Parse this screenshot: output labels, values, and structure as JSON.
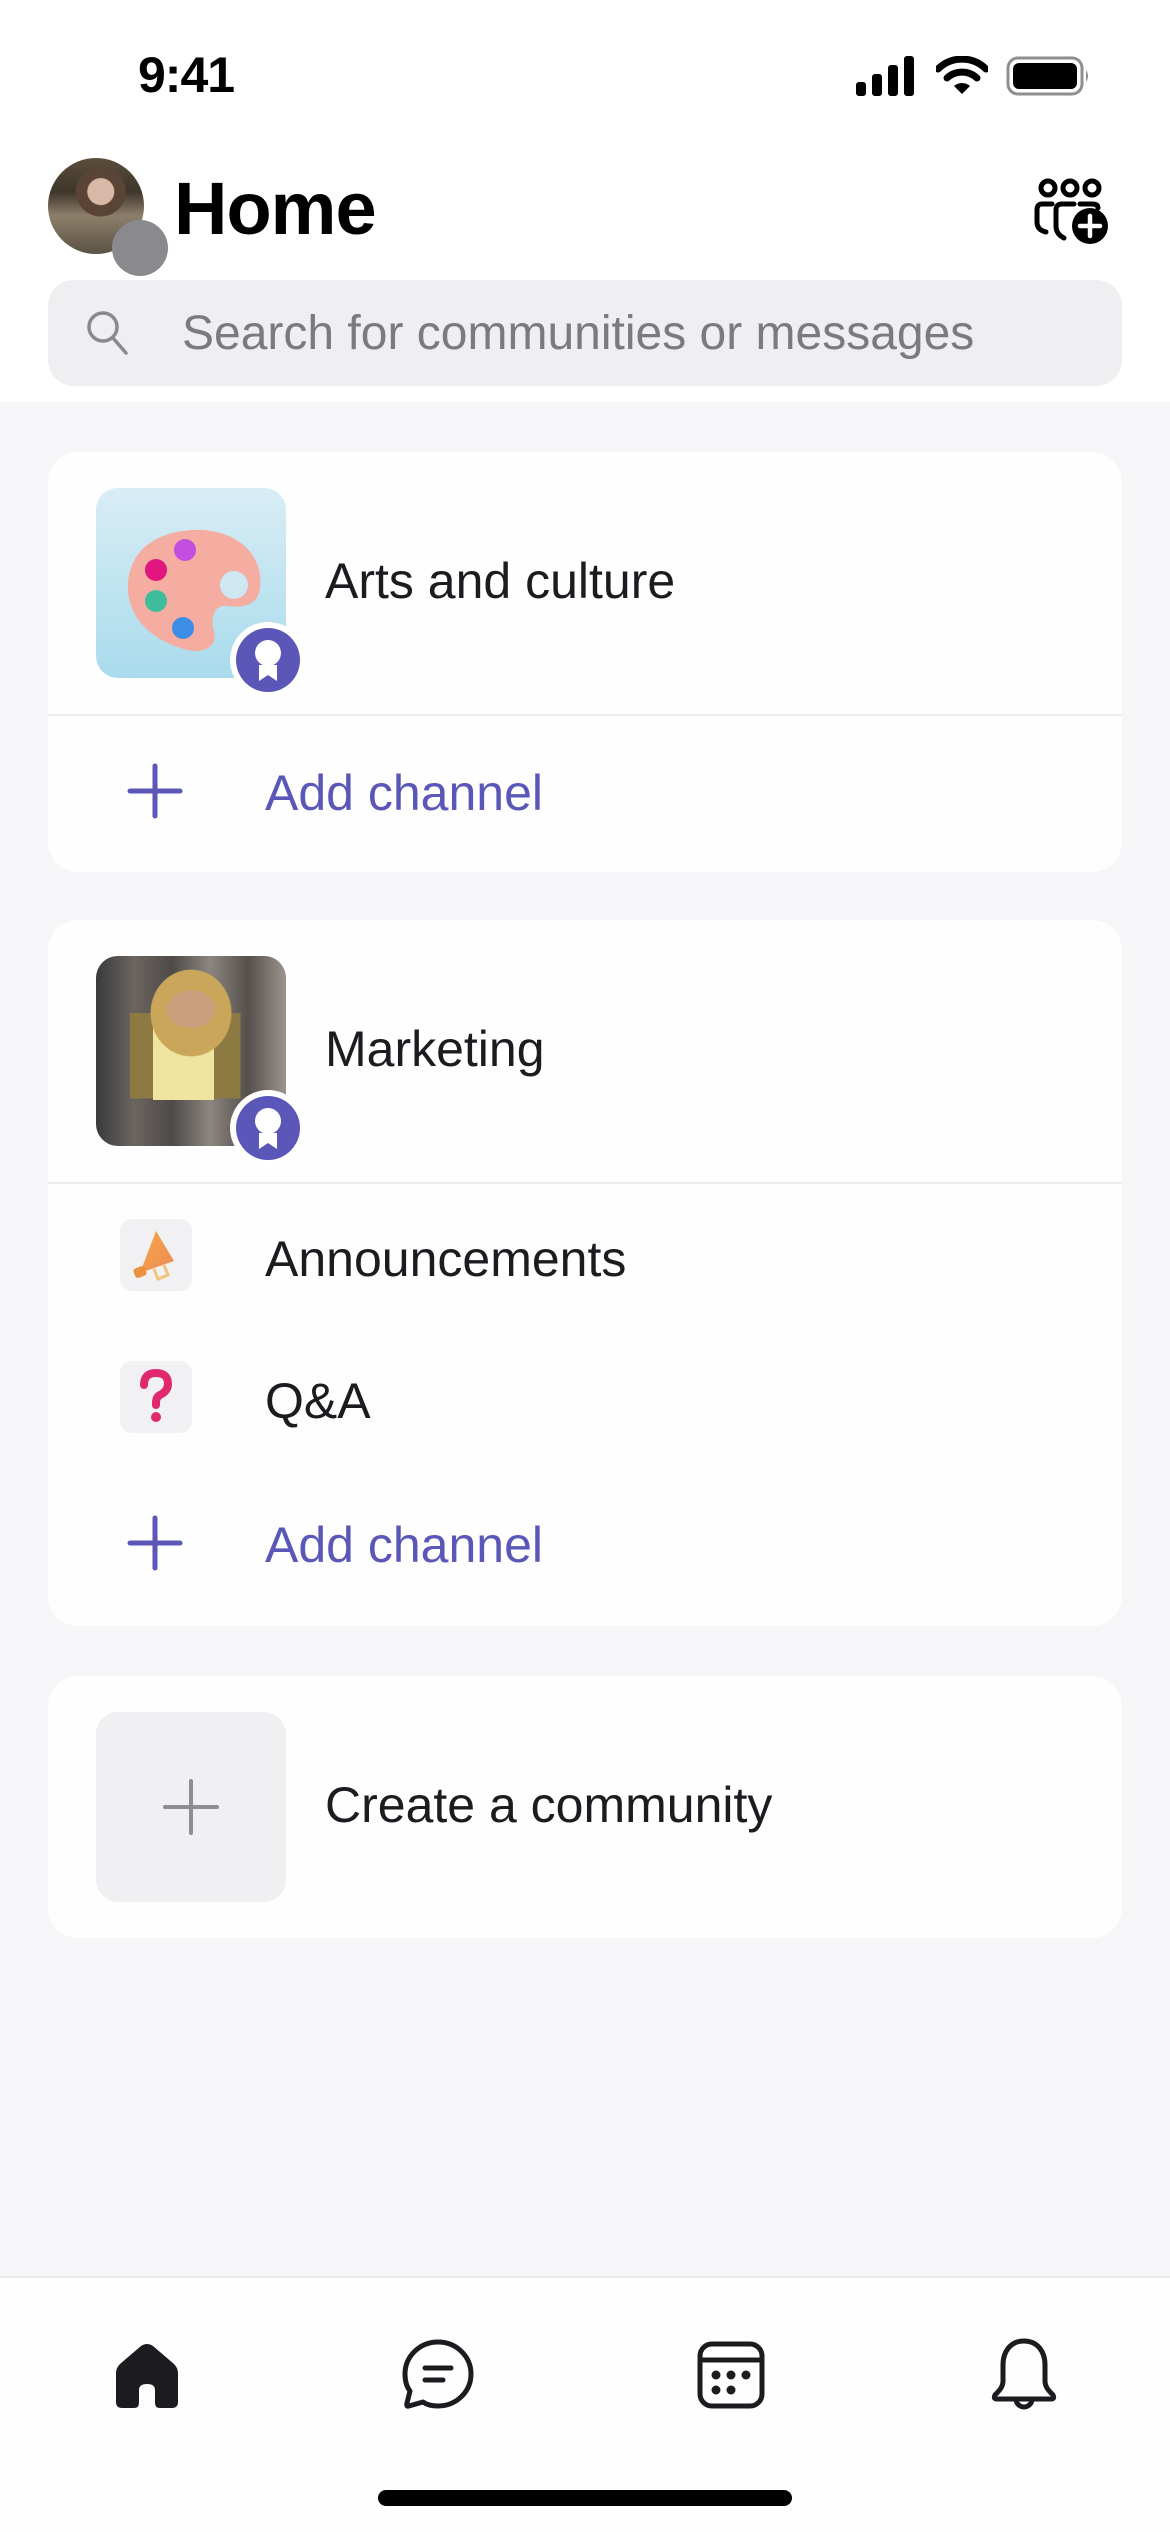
{
  "status_bar": {
    "time": "9:41",
    "icons": [
      "cellular-signal-icon",
      "wifi-icon",
      "battery-icon"
    ]
  },
  "header": {
    "title": "Home",
    "avatar_alt": "User avatar",
    "presence": "offline",
    "action_icon": "community-add-icon"
  },
  "search": {
    "placeholder": "Search for communities or messages",
    "value": "",
    "icon": "search-icon"
  },
  "communities": [
    {
      "name": "Arts and culture",
      "thumbnail": "palette-icon",
      "badge": "award-ribbon-icon",
      "channels": [],
      "add_channel_label": "Add channel"
    },
    {
      "name": "Marketing",
      "thumbnail": "photo-woman-plaid-blazer",
      "badge": "award-ribbon-icon",
      "channels": [
        {
          "label": "Announcements",
          "icon": "megaphone-icon"
        },
        {
          "label": "Q&A",
          "icon": "question-mark-icon"
        }
      ],
      "add_channel_label": "Add channel"
    }
  ],
  "create_community": {
    "label": "Create a community",
    "icon": "plus-icon"
  },
  "bottom_nav": {
    "items": [
      {
        "name": "home",
        "icon": "home-icon",
        "active": true
      },
      {
        "name": "chat",
        "icon": "chat-bubble-icon",
        "active": false
      },
      {
        "name": "calendar",
        "icon": "calendar-icon",
        "active": false
      },
      {
        "name": "notifications",
        "icon": "bell-icon",
        "active": false
      }
    ]
  },
  "colors": {
    "accent": "#5b57b8",
    "background": "#f6f5f8",
    "card": "#fefefe",
    "search_bg": "#efeef1",
    "text_primary": "#1c1b1f",
    "text_placeholder": "#7b7a80",
    "presence_offline": "#8a8a8e"
  }
}
